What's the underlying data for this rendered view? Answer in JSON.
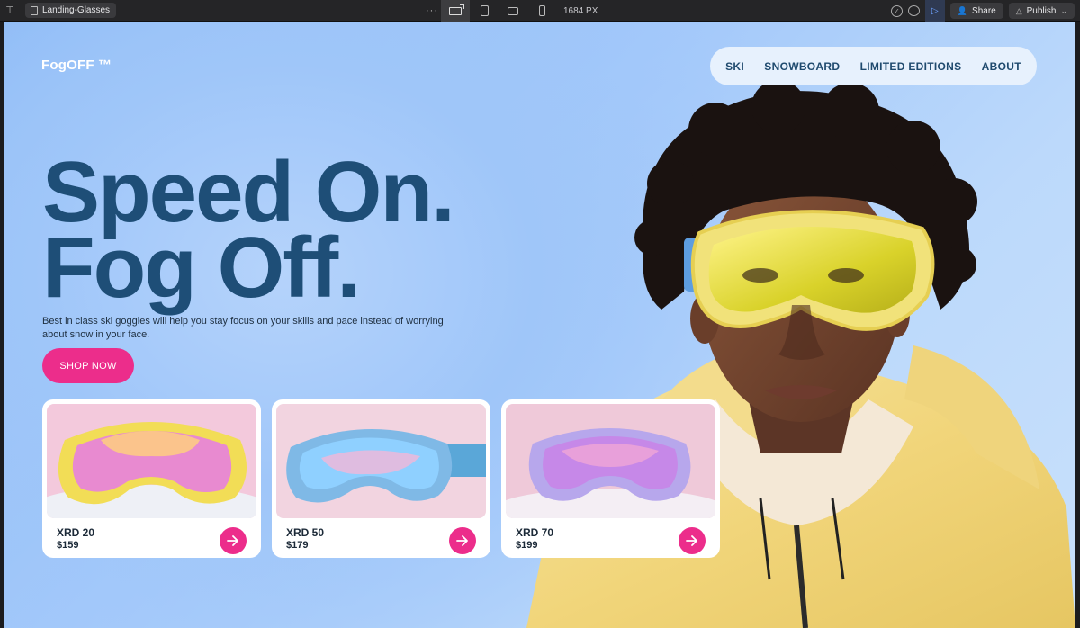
{
  "editor": {
    "tab_title": "Landing-Glasses",
    "more_label": "···",
    "canvas_width_label": "1684 PX",
    "share_label": "Share",
    "publish_label": "Publish"
  },
  "site": {
    "brand": "FogOFF ™",
    "nav": [
      "SKI",
      "SNOWBOARD",
      "LIMITED EDITIONS",
      "ABOUT"
    ],
    "headline_line1": "Speed On.",
    "headline_line2": "Fog Off.",
    "subtitle": "Best in class ski goggles will help you stay focus on your skills and pace instead of worrying about snow in your face.",
    "cta_label": "SHOP NOW",
    "products": [
      {
        "name": "XRD 20",
        "price": "$159",
        "frame_color": "#f2dd56",
        "lens_color": "#e88ad0",
        "bg_color": "#f3c9dc"
      },
      {
        "name": "XRD 50",
        "price": "$179",
        "frame_color": "#7fb9e6",
        "lens_color": "#8fd0ff",
        "bg_color": "#f2d4e0"
      },
      {
        "name": "XRD 70",
        "price": "$199",
        "frame_color": "#b7a7ec",
        "lens_color": "#c688e8",
        "bg_color": "#efc9d9"
      }
    ]
  },
  "colors": {
    "accent": "#ec2d8b",
    "headline": "#1e4e77",
    "nav_bg": "#e7f1fd"
  }
}
